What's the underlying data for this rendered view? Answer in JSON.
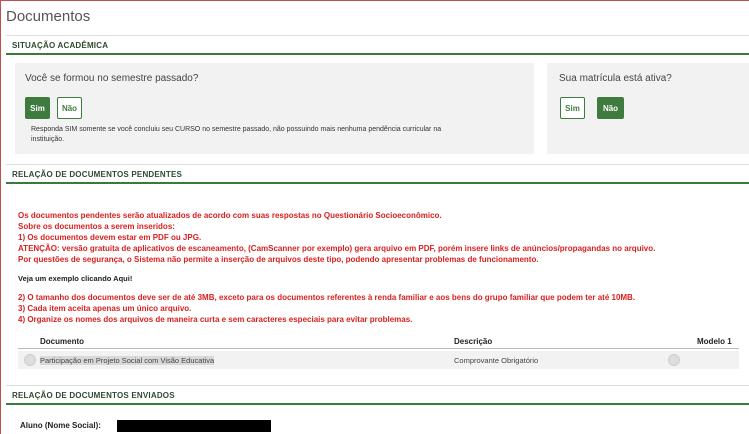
{
  "page": {
    "title": "Documentos"
  },
  "situacao": {
    "header": "SITUAÇÃO ACADÊMICA",
    "formou": {
      "question": "Você se formou no semestre passado?",
      "sim": "Sim",
      "nao": "Não",
      "selected": "Sim",
      "hint_line1": "Responda SIM somente se você concluiu seu CURSO no semestre passado, não possuindo mais nenhuma pendência curricular na",
      "hint_line2": "instituição."
    },
    "matricula": {
      "question": "Sua matrícula está ativa?",
      "sim": "Sim",
      "nao": "Não",
      "selected": "Não"
    }
  },
  "pendentes": {
    "header": "RELAÇÃO DE DOCUMENTOS PENDENTES",
    "notice": [
      "Os documentos pendentes serão atualizados de acordo com suas respostas no Questionário Socioeconômico.",
      "Sobre os documentos a serem inseridos:",
      "1) Os documentos devem estar em PDF ou JPG.",
      "ATENÇÃO: versão gratuita de aplicativos de escaneamento, (CamScanner por exemplo) gera arquivo em PDF, porém insere links de anúncios/propagandas no arquivo.",
      "Por questões de segurança, o Sistema não permite a inserção de arquivos deste tipo, podendo apresentar problemas de funcionamento."
    ],
    "example_link": "Veja um exemplo clicando Aqui!",
    "rules": [
      "2) O tamanho dos documentos deve ser de até 3MB, exceto para os documentos referentes à renda familiar e aos bens do grupo familiar que podem ter até 10MB.",
      "3) Cada item aceita apenas um único arquivo.",
      "4) Organize os nomes dos arquivos de maneira curta e sem caracteres especiais para evitar problemas."
    ],
    "table": {
      "columns": [
        "Documento",
        "Descrição",
        "Modelo 1"
      ],
      "rows": [
        {
          "documento": "Participação em Projeto Social com Visão Educativa",
          "descricao": "Comprovante Obrigatório"
        }
      ]
    }
  },
  "enviados": {
    "header": "RELAÇÃO DE DOCUMENTOS ENVIADOS",
    "student_label": "Aluno (Nome Social):"
  },
  "colors": {
    "accent": "#3f7a3f",
    "warning": "#d91f1f",
    "panel": "#f2f2f2"
  }
}
